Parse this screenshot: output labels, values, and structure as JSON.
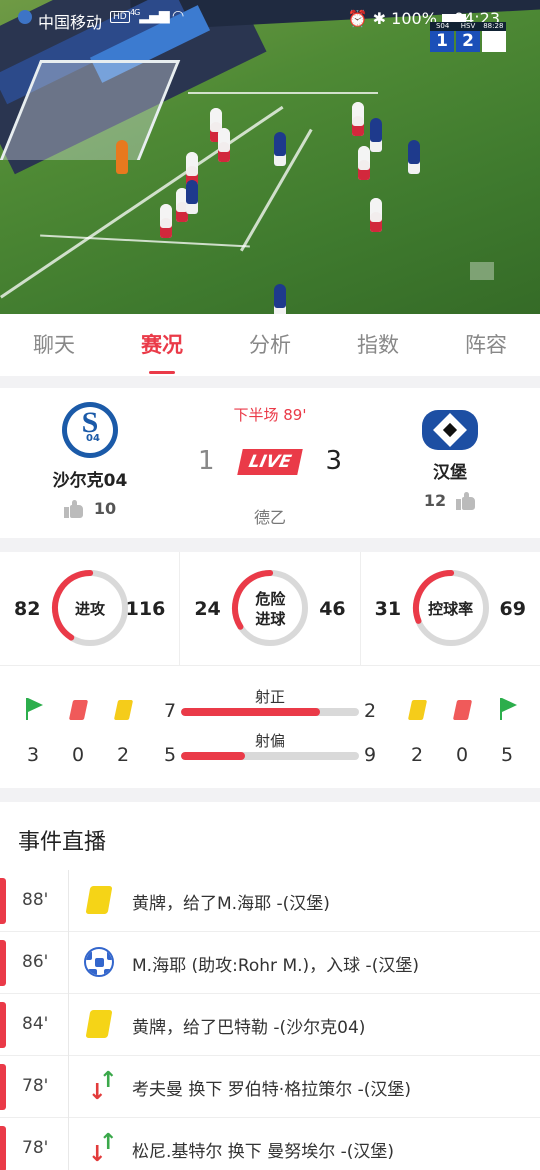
{
  "status_bar": {
    "carrier": "中国移动",
    "network_badge": "HD",
    "network_type": "4G",
    "battery": "100%",
    "time": "04:23"
  },
  "video": {
    "scorebug": {
      "home_abbr": "S04",
      "away_abbr": "HSV",
      "clock": "88:28",
      "home_score": "1",
      "away_score": "2"
    }
  },
  "tabs": [
    {
      "label": "聊天"
    },
    {
      "label": "赛况"
    },
    {
      "label": "分析"
    },
    {
      "label": "指数"
    },
    {
      "label": "阵容"
    }
  ],
  "match": {
    "period": "下半场 89'",
    "live_label": "LIVE",
    "league": "德乙",
    "home": {
      "name": "沙尔克04",
      "score": "1",
      "likes": "10"
    },
    "away": {
      "name": "汉堡",
      "score": "3",
      "likes": "12"
    }
  },
  "stats": {
    "rings": [
      {
        "label": "进攻",
        "home": "82",
        "away": "116",
        "home_share": 0.41
      },
      {
        "label": "危险进球",
        "home": "24",
        "away": "46",
        "home_share": 0.34
      },
      {
        "label": "控球率",
        "home": "31",
        "away": "69",
        "home_share": 0.31
      }
    ],
    "home_corners": "3",
    "home_red": "0",
    "home_yellow": "2",
    "away_yellow": "2",
    "away_red": "0",
    "away_corners": "5",
    "bars": [
      {
        "label": "射正",
        "home": "7",
        "away": "2",
        "home_share": 0.78
      },
      {
        "label": "射偏",
        "home": "5",
        "away": "9",
        "home_share": 0.36
      }
    ],
    "colors": {
      "accent": "#ea3a48",
      "track": "#d9d9d9",
      "corner_flag": "#2cae4c",
      "red_card": "#f05a5a",
      "yellow_card": "#f5cc1a"
    }
  },
  "events": {
    "title": "事件直播",
    "items": [
      {
        "minute": "88'",
        "icon": "yellow-card-icon",
        "text": "黄牌，给了M.海耶 -(汉堡)"
      },
      {
        "minute": "86'",
        "icon": "soccer-ball-icon",
        "text": "M.海耶 (助攻:Rohr M.)，入球 -(汉堡)"
      },
      {
        "minute": "84'",
        "icon": "yellow-card-icon",
        "text": "黄牌，给了巴特勒 -(沙尔克04)"
      },
      {
        "minute": "78'",
        "icon": "substitution-icon",
        "text": "考夫曼 换下 罗伯特·格拉策尔 -(汉堡)"
      },
      {
        "minute": "78'",
        "icon": "substitution-icon",
        "text": "松尼.基特尔 换下 曼努埃尔 -(汉堡)"
      }
    ]
  }
}
